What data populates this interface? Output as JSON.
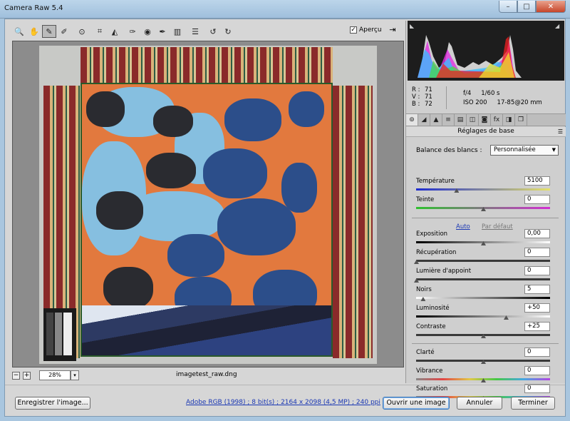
{
  "window": {
    "title": "Camera Raw 5.4"
  },
  "toolbar": {
    "tools": [
      {
        "name": "zoom-tool-icon",
        "glyph": "🔍"
      },
      {
        "name": "hand-tool-icon",
        "glyph": "✋"
      },
      {
        "name": "white-balance-tool-icon",
        "glyph": "✎"
      },
      {
        "name": "color-sampler-tool-icon",
        "glyph": "✐"
      },
      {
        "name": "targeted-adjustment-tool-icon",
        "glyph": "⊙"
      },
      {
        "name": "crop-tool-icon",
        "glyph": "⌗"
      },
      {
        "name": "straighten-tool-icon",
        "glyph": "◭"
      },
      {
        "name": "spot-removal-tool-icon",
        "glyph": "✑"
      },
      {
        "name": "red-eye-tool-icon",
        "glyph": "◉"
      },
      {
        "name": "adjustment-brush-icon",
        "glyph": "✒"
      },
      {
        "name": "graduated-filter-icon",
        "glyph": "▥"
      },
      {
        "name": "preferences-icon",
        "glyph": "☰"
      },
      {
        "name": "rotate-left-icon",
        "glyph": "↺"
      },
      {
        "name": "rotate-right-icon",
        "glyph": "↻"
      }
    ],
    "preview_label": "Aperçu",
    "preview_checked": "✓"
  },
  "zoom": {
    "minus": "−",
    "plus": "+",
    "value": "28%",
    "dropdown": "▾"
  },
  "file": {
    "name": "imagetest_raw.dng"
  },
  "readout": {
    "r_label": "R :",
    "r": "71",
    "v_label": "V :",
    "v": "71",
    "b_label": "B :",
    "b": "72",
    "aperture": "f/4",
    "shutter": "1/60 s",
    "iso": "ISO 200",
    "lens": "17-85@20 mm"
  },
  "panel": {
    "title": "Réglages de base",
    "tabs": [
      "⊚",
      "◢",
      "▲",
      "≡",
      "▤",
      "◫",
      "◙",
      "fx",
      "◨",
      "❐"
    ],
    "white_balance_label": "Balance des blancs :",
    "white_balance_value": "Personnalisée",
    "auto_label": "Auto",
    "default_label": "Par défaut",
    "sliders": [
      {
        "key": "temperature",
        "label": "Température",
        "value": "5100",
        "pos": 0.3,
        "track": "temp"
      },
      {
        "key": "tint",
        "label": "Teinte",
        "value": "0",
        "pos": 0.5,
        "track": "tint"
      },
      {
        "key": "exposure",
        "label": "Exposition",
        "value": "0,00",
        "pos": 0.5,
        "track": "exposure"
      },
      {
        "key": "recovery",
        "label": "Récupération",
        "value": "0",
        "pos": 0.0,
        "track": "gray"
      },
      {
        "key": "fill-light",
        "label": "Lumière d'appoint",
        "value": "0",
        "pos": 0.0,
        "track": "gray"
      },
      {
        "key": "blacks",
        "label": "Noirs",
        "value": "5",
        "pos": 0.05,
        "track": "black"
      },
      {
        "key": "brightness",
        "label": "Luminosité",
        "value": "+50",
        "pos": 0.67,
        "track": "exposure"
      },
      {
        "key": "contrast",
        "label": "Contraste",
        "value": "+25",
        "pos": 0.5,
        "track": "gray"
      },
      {
        "key": "clarity",
        "label": "Clarté",
        "value": "0",
        "pos": 0.5,
        "track": "gray"
      },
      {
        "key": "vibrance",
        "label": "Vibrance",
        "value": "0",
        "pos": 0.5,
        "track": "sat"
      },
      {
        "key": "saturation",
        "label": "Saturation",
        "value": "0",
        "pos": 0.5,
        "track": "sat"
      }
    ]
  },
  "footer": {
    "save_label": "Enregistrer l'image...",
    "workflow_label": "Adobe RGB (1998) ; 8 bit(s) ; 2164 x 2098 (4,5 MP) ; 240 ppi",
    "open_label": "Ouvrir une image",
    "cancel_label": "Annuler",
    "done_label": "Terminer"
  },
  "colors": {
    "accent_link": "#1a37b3",
    "quilt_orange": "#e2793e",
    "quilt_blue": "#86bfe0",
    "frame_red": "#8a2a2a"
  }
}
